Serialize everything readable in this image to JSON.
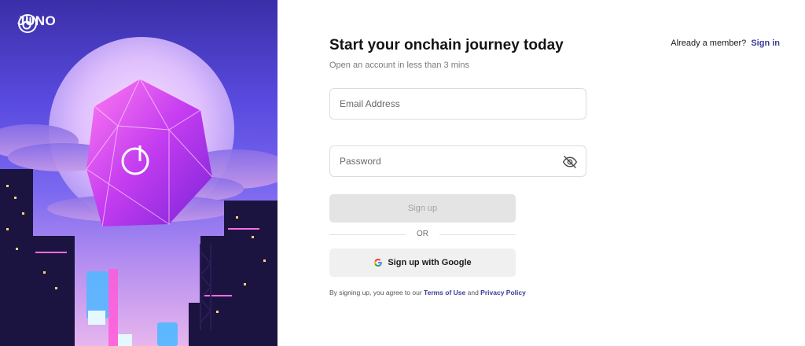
{
  "brand": {
    "name": "JUNO"
  },
  "form": {
    "heading": "Start your onchain journey today",
    "subheading": "Open an account in less than 3 mins",
    "member_prompt": "Already a member?",
    "signin_label": "Sign in",
    "email_placeholder": "Email Address",
    "password_placeholder": "Password",
    "signup_label": "Sign up",
    "or_label": "OR",
    "google_label": "Sign up with Google",
    "terms_prefix": "By signing up, you agree to our ",
    "terms_link": "Terms of Use",
    "terms_and": " and ",
    "privacy_link": "Privacy Policy"
  },
  "colors": {
    "accent_link": "#3b3b9a",
    "button_disabled_bg": "#e4e4e4",
    "google_button_bg": "#f0f0f0"
  },
  "icons": {
    "brand_logo": "juno-logo-icon",
    "password_toggle": "eye-off-icon",
    "google": "google-g-icon"
  }
}
